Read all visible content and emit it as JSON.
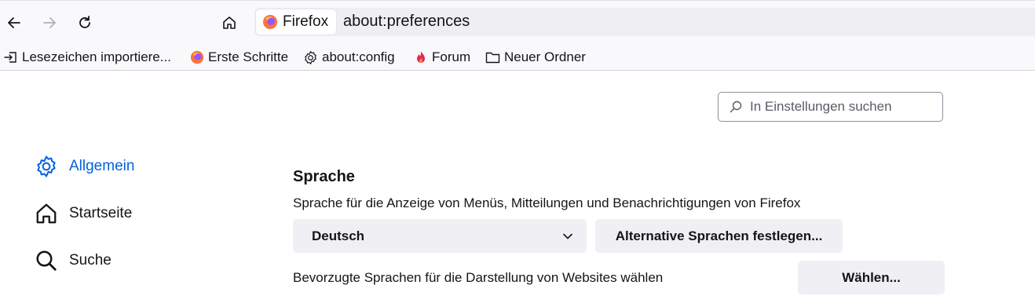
{
  "toolbar": {
    "identity_label": "Firefox",
    "url": "about:preferences"
  },
  "bookmarks": [
    {
      "label": "Lesezeichen importiere...",
      "icon": "import-icon"
    },
    {
      "label": "Erste Schritte",
      "icon": "firefox-icon"
    },
    {
      "label": "about:config",
      "icon": "gear-icon"
    },
    {
      "label": "Forum",
      "icon": "flame-icon"
    },
    {
      "label": "Neuer Ordner",
      "icon": "folder-icon"
    }
  ],
  "search": {
    "placeholder": "In Einstellungen suchen"
  },
  "sidebar": {
    "items": [
      {
        "label": "Allgemein",
        "icon": "gear-icon",
        "selected": true
      },
      {
        "label": "Startseite",
        "icon": "home-icon"
      },
      {
        "label": "Suche",
        "icon": "search-icon"
      }
    ]
  },
  "language": {
    "heading": "Sprache",
    "description": "Sprache für die Anzeige von Menüs, Mitteilungen und Benachrichtigungen von Firefox",
    "selected": "Deutsch",
    "alt_button": "Alternative Sprachen festlegen...",
    "preferred_description": "Bevorzugte Sprachen für die Darstellung von Websites wählen",
    "choose_button": "Wählen..."
  },
  "colors": {
    "accent": "#0061e0",
    "toolbar_bg": "#f9f9fb",
    "button_bg": "#f0f0f4"
  }
}
